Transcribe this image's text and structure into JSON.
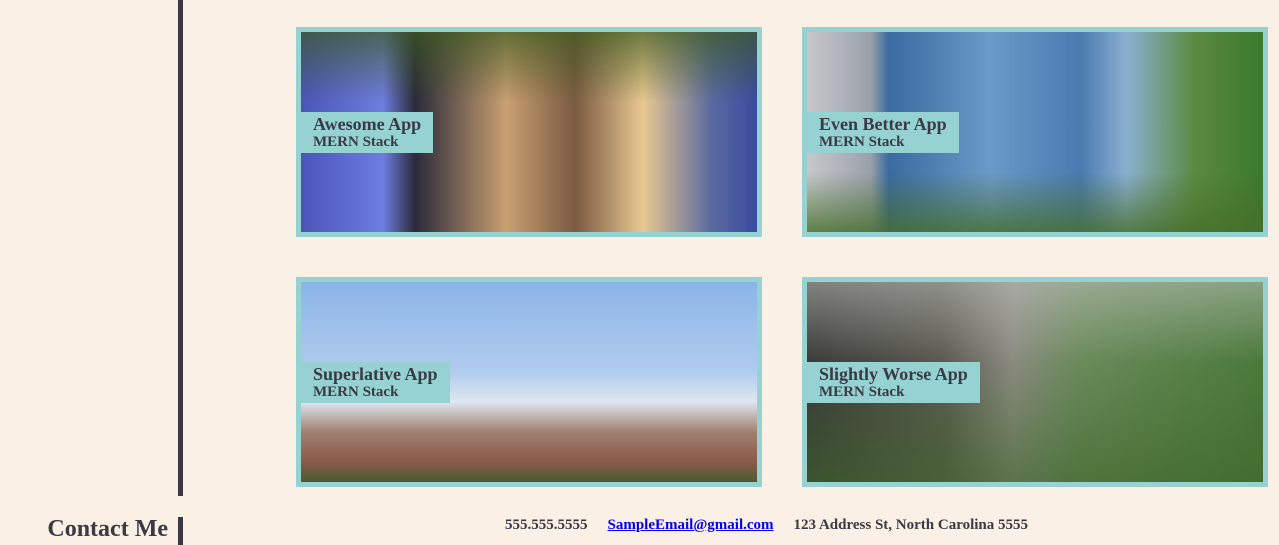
{
  "projects": [
    {
      "title": "Awesome App",
      "stack": "MERN Stack"
    },
    {
      "title": "Even Better App",
      "stack": "MERN Stack"
    },
    {
      "title": "Superlative App",
      "stack": "MERN Stack"
    },
    {
      "title": "Slightly Worse App",
      "stack": "MERN Stack"
    }
  ],
  "contact": {
    "heading": "Contact Me",
    "phone": "555.555.5555",
    "email": "SampleEmail@gmail.com",
    "address": "123 Address St, North Carolina 5555"
  },
  "colors": {
    "background": "#faf0e6",
    "accent": "#96d2d2",
    "text": "#3a3a45"
  }
}
